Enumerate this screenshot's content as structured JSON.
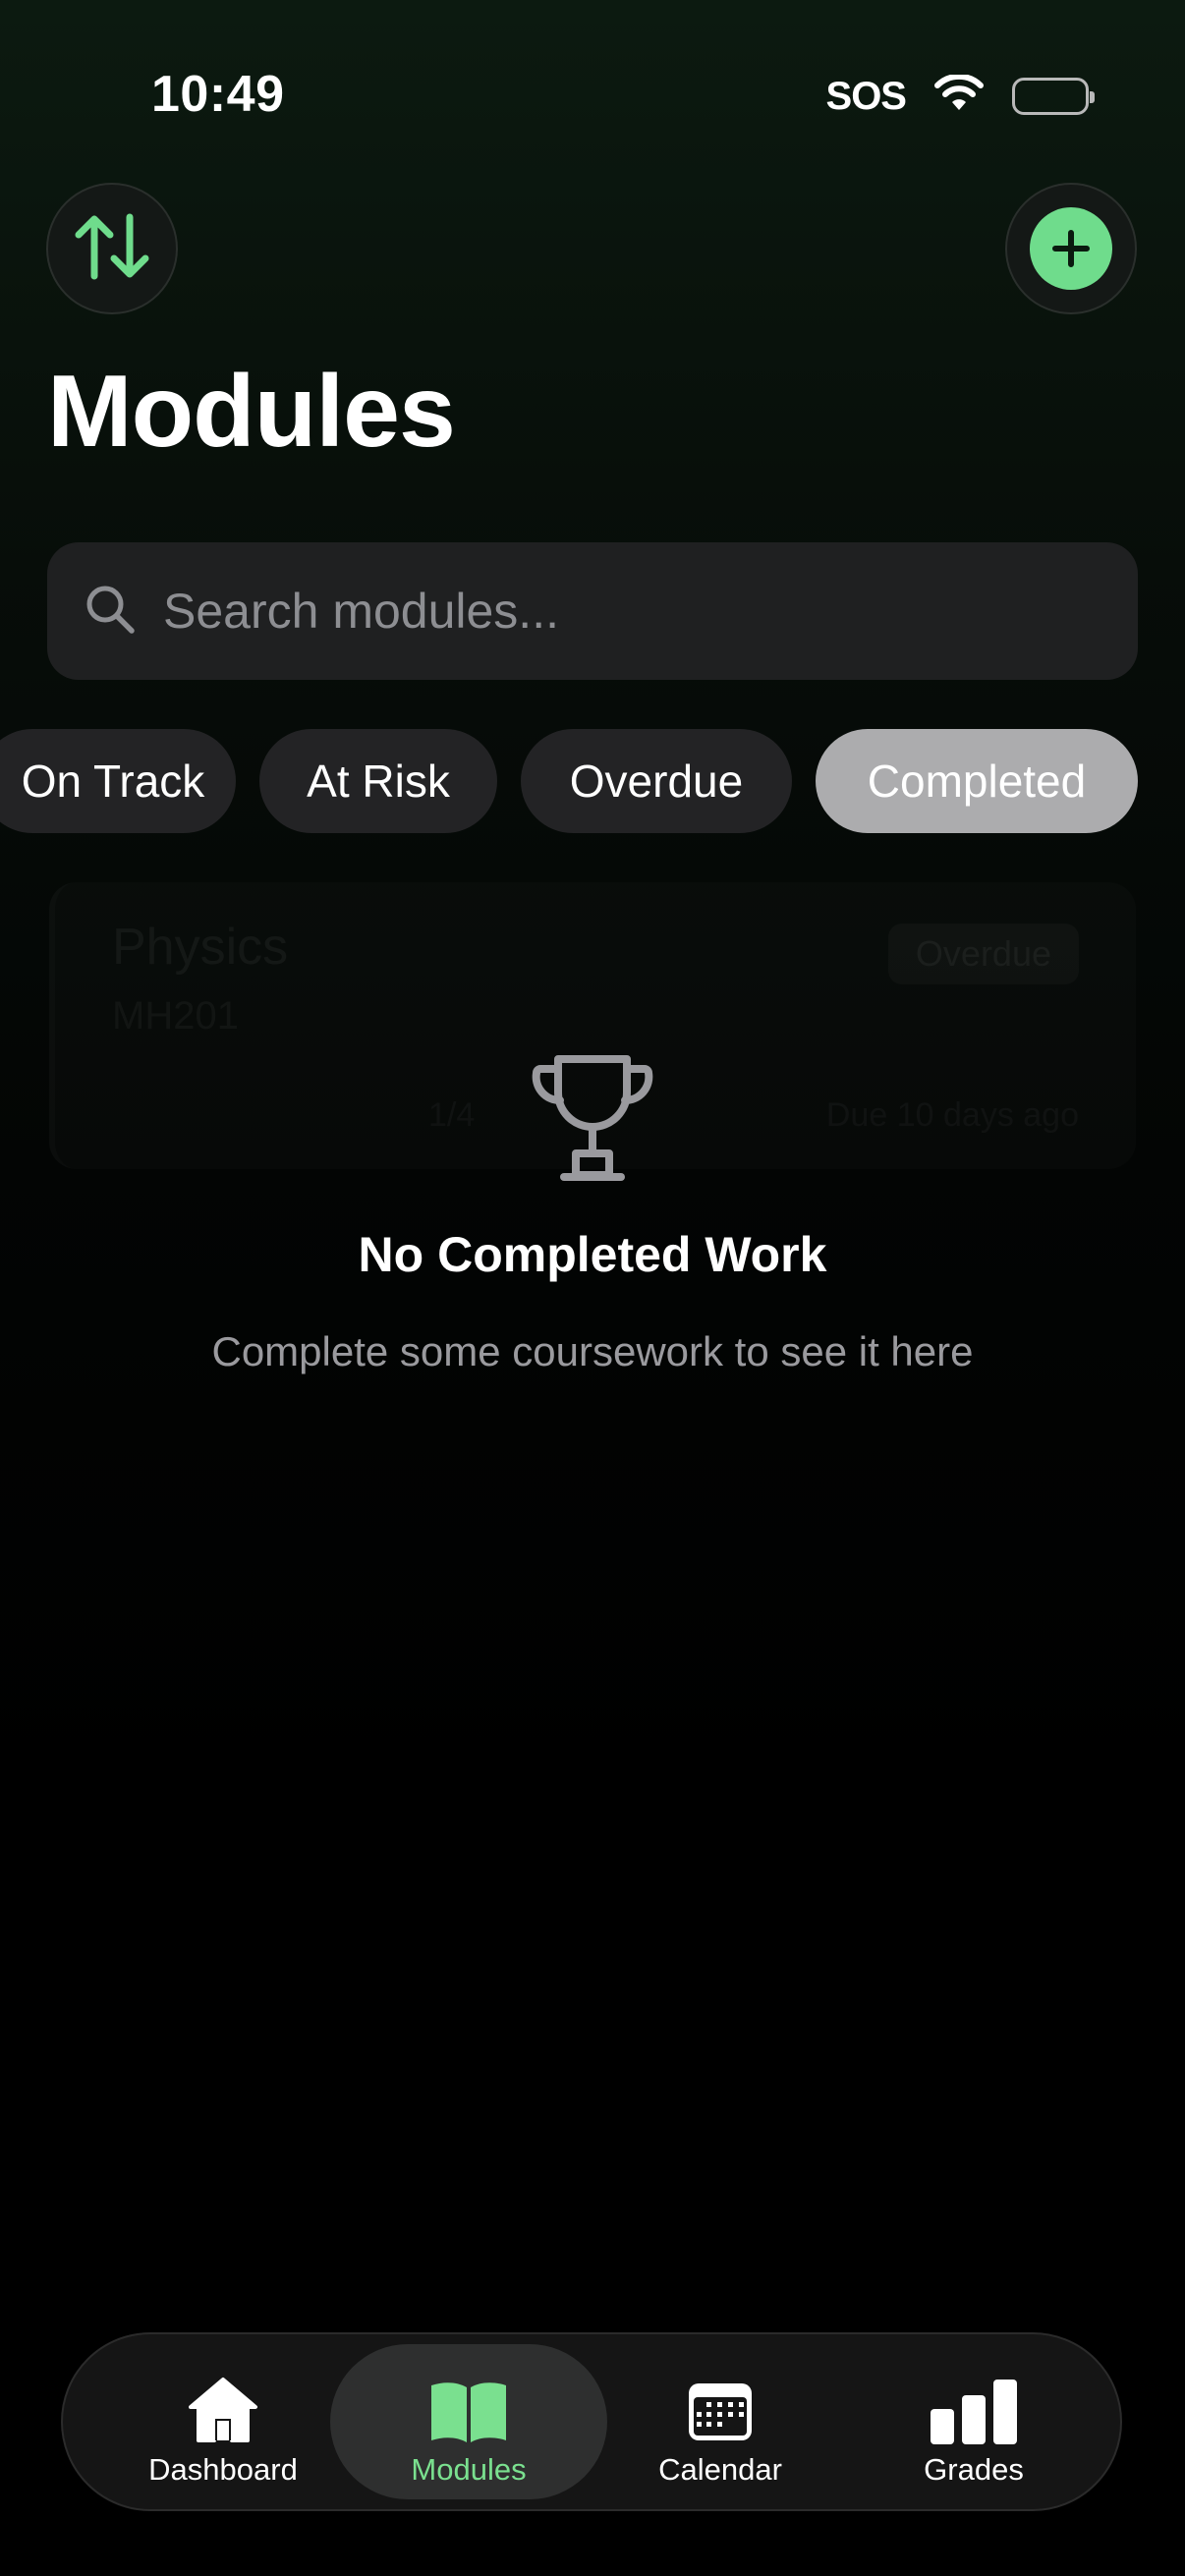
{
  "status_bar": {
    "time": "10:49",
    "carrier": "SOS"
  },
  "header": {
    "title": "Modules"
  },
  "search": {
    "placeholder": "Search modules..."
  },
  "filters": [
    {
      "label": "On Track",
      "active": false
    },
    {
      "label": "At Risk",
      "active": false
    },
    {
      "label": "Overdue",
      "active": false
    },
    {
      "label": "Completed",
      "active": true
    }
  ],
  "background_card": {
    "title": "Physics",
    "code": "MH201",
    "badge": "Overdue",
    "meta_left": "1/4",
    "meta_right": "Due 10 days ago"
  },
  "empty_state": {
    "icon": "trophy-icon",
    "title": "No Completed Work",
    "subtitle": "Complete some coursework to see it here"
  },
  "tabs": [
    {
      "label": "Dashboard",
      "icon": "house-icon",
      "active": false
    },
    {
      "label": "Modules",
      "icon": "book-icon",
      "active": true
    },
    {
      "label": "Calendar",
      "icon": "calendar-icon",
      "active": false
    },
    {
      "label": "Grades",
      "icon": "chart-bar-icon",
      "active": false
    }
  ],
  "colors": {
    "accent": "#6fdc8c",
    "active_tab_label": "#7ae08f",
    "chip_active": "#acacae"
  }
}
